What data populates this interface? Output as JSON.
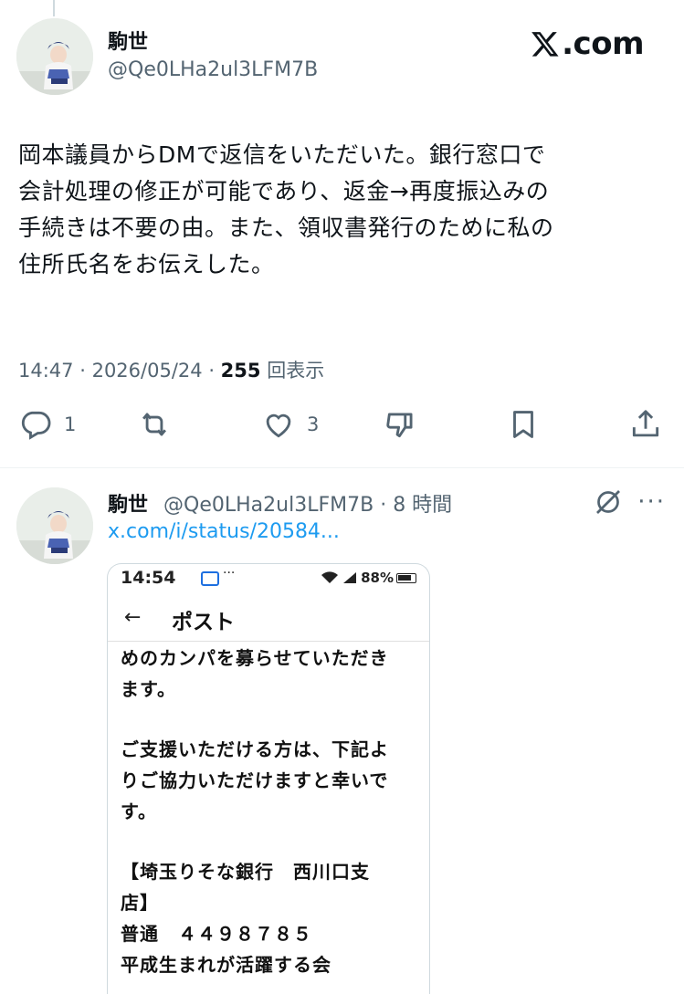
{
  "tweet": {
    "author_name": "駒世",
    "author_handle": "@Qe0LHa2ul3LFM7B",
    "brand": ".com",
    "text_lines": [
      "岡本議員からDMで返信をいただいた。銀行窓口で",
      "会計処理の修正が可能であり、返金→再度振込みの",
      "手続きは不要の由。また、領収書発行のために私の",
      "住所氏名をお伝えした。"
    ],
    "time": "14:47",
    "date": "2026/05/24",
    "views": "255",
    "views_label": "回表示",
    "reply_count": "1",
    "like_count": "3"
  },
  "reply": {
    "author_name": "駒世",
    "author_handle": "@Qe0LHa2ul3LFM7B",
    "time_ago": "8 時間",
    "link": "x.com/i/status/20584...",
    "more": "···"
  },
  "screenshot": {
    "status_time": "14:54",
    "status_dots": "···",
    "battery": "88%",
    "back": "←",
    "title": "ポスト",
    "lines": [
      "めのカンパを募らせていただき",
      "ます。",
      "",
      "ご支援いただける方は、下記よ",
      "りご協力いただけますと幸いで",
      "す。",
      "",
      "【埼玉りそな銀行　西川口支",
      "店】",
      "普通　４４９８７８５",
      "平成生まれが活躍する会"
    ]
  },
  "icons": {
    "reply": "reply-icon",
    "retweet": "retweet-icon",
    "like": "heart-icon",
    "dislike": "thumbs-down-icon",
    "bookmark": "bookmark-icon",
    "share": "share-icon",
    "grok": "grok-icon",
    "mail": "mail-icon",
    "wifi": "wifi-icon",
    "signal": "signal-icon"
  }
}
